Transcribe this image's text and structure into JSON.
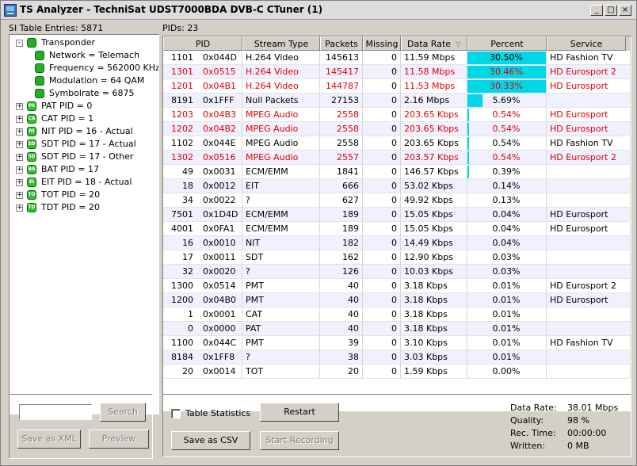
{
  "window": {
    "title": "TS Analyzer - TechniSat UDST7000BDA DVB-C CTuner (1)",
    "min_glyph": "_",
    "max_glyph": "□",
    "close_glyph": "×"
  },
  "left": {
    "label": "SI Table Entries: 5871",
    "tree": [
      {
        "text": "Transponder",
        "toggle": "-",
        "icon": "round",
        "level": 0
      },
      {
        "text": "Network = Telemach",
        "icon": "round",
        "level": 1
      },
      {
        "text": "Frequency = 562000 KHz",
        "icon": "round",
        "level": 1
      },
      {
        "text": "Modulation = 64 QAM",
        "icon": "round",
        "level": 1
      },
      {
        "text": "Symbolrate = 6875",
        "icon": "round",
        "level": 1
      },
      {
        "text": "PAT PID = 0",
        "toggle": "+",
        "icon": "table",
        "badge": "PA",
        "level": 0
      },
      {
        "text": "CAT PID = 1",
        "toggle": "+",
        "icon": "table",
        "badge": "CA",
        "level": 0
      },
      {
        "text": "NIT PID = 16 - Actual",
        "toggle": "+",
        "icon": "table",
        "badge": "NI",
        "level": 0
      },
      {
        "text": "SDT PID = 17 - Actual",
        "toggle": "+",
        "icon": "table",
        "badge": "SD",
        "level": 0
      },
      {
        "text": "SDT PID = 17 - Other",
        "toggle": "+",
        "icon": "table",
        "badge": "SD",
        "level": 0
      },
      {
        "text": "BAT PID = 17",
        "toggle": "+",
        "icon": "table",
        "badge": "BA",
        "level": 0
      },
      {
        "text": "EIT PID = 18 - Actual",
        "toggle": "+",
        "icon": "table",
        "badge": "EI",
        "level": 0
      },
      {
        "text": "TOT PID = 20",
        "toggle": "+",
        "icon": "table",
        "badge": "TO",
        "level": 0
      },
      {
        "text": "TDT PID = 20",
        "toggle": "+",
        "icon": "table",
        "badge": "TD",
        "level": 0
      }
    ],
    "search_value": "",
    "search_button": "Search",
    "save_xml_button": "Save as XML",
    "preview_button": "Preview"
  },
  "right": {
    "label": "PIDs: 23",
    "columns": [
      "PID",
      "Stream Type",
      "Packets",
      "Missing",
      "Data Rate",
      "Percent",
      "Service"
    ],
    "rows": [
      {
        "pid_dec": "1101",
        "pid_hex": "0x044D",
        "type": "H.264 Video",
        "packets": "145613",
        "missing": "0",
        "rate": "11.59 Mbps",
        "percent": "30.50%",
        "pct": 30.5,
        "service": "HD Fashion TV",
        "red": false
      },
      {
        "pid_dec": "1301",
        "pid_hex": "0x0515",
        "type": "H.264 Video",
        "packets": "145417",
        "missing": "0",
        "rate": "11.58 Mbps",
        "percent": "30.46%",
        "pct": 30.46,
        "service": "HD Eurosport 2",
        "red": true
      },
      {
        "pid_dec": "1201",
        "pid_hex": "0x04B1",
        "type": "H.264 Video",
        "packets": "144787",
        "missing": "0",
        "rate": "11.53 Mbps",
        "percent": "30.33%",
        "pct": 30.33,
        "service": "HD Eurosport",
        "red": true
      },
      {
        "pid_dec": "8191",
        "pid_hex": "0x1FFF",
        "type": "Null Packets",
        "packets": "27153",
        "missing": "0",
        "rate": "2.16 Mbps",
        "percent": "5.69%",
        "pct": 5.69,
        "service": "",
        "red": false
      },
      {
        "pid_dec": "1203",
        "pid_hex": "0x04B3",
        "type": "MPEG Audio",
        "packets": "2558",
        "missing": "0",
        "rate": "203.65 Kbps",
        "percent": "0.54%",
        "pct": 0.54,
        "service": "HD Eurosport",
        "red": true
      },
      {
        "pid_dec": "1202",
        "pid_hex": "0x04B2",
        "type": "MPEG Audio",
        "packets": "2558",
        "missing": "0",
        "rate": "203.65 Kbps",
        "percent": "0.54%",
        "pct": 0.54,
        "service": "HD Eurosport",
        "red": true
      },
      {
        "pid_dec": "1102",
        "pid_hex": "0x044E",
        "type": "MPEG Audio",
        "packets": "2558",
        "missing": "0",
        "rate": "203.65 Kbps",
        "percent": "0.54%",
        "pct": 0.54,
        "service": "HD Fashion TV",
        "red": false
      },
      {
        "pid_dec": "1302",
        "pid_hex": "0x0516",
        "type": "MPEG Audio",
        "packets": "2557",
        "missing": "0",
        "rate": "203.57 Kbps",
        "percent": "0.54%",
        "pct": 0.54,
        "service": "HD Eurosport 2",
        "red": true
      },
      {
        "pid_dec": "49",
        "pid_hex": "0x0031",
        "type": "ECM/EMM",
        "packets": "1841",
        "missing": "0",
        "rate": "146.57 Kbps",
        "percent": "0.39%",
        "pct": 0.39,
        "service": "",
        "red": false
      },
      {
        "pid_dec": "18",
        "pid_hex": "0x0012",
        "type": "EIT",
        "packets": "666",
        "missing": "0",
        "rate": "53.02 Kbps",
        "percent": "0.14%",
        "pct": 0.14,
        "service": "",
        "red": false
      },
      {
        "pid_dec": "34",
        "pid_hex": "0x0022",
        "type": "?",
        "packets": "627",
        "missing": "0",
        "rate": "49.92 Kbps",
        "percent": "0.13%",
        "pct": 0.13,
        "service": "",
        "red": false
      },
      {
        "pid_dec": "7501",
        "pid_hex": "0x1D4D",
        "type": "ECM/EMM",
        "packets": "189",
        "missing": "0",
        "rate": "15.05 Kbps",
        "percent": "0.04%",
        "pct": 0.04,
        "service": "HD Eurosport",
        "red": false
      },
      {
        "pid_dec": "4001",
        "pid_hex": "0x0FA1",
        "type": "ECM/EMM",
        "packets": "189",
        "missing": "0",
        "rate": "15.05 Kbps",
        "percent": "0.04%",
        "pct": 0.04,
        "service": "HD Eurosport",
        "red": false
      },
      {
        "pid_dec": "16",
        "pid_hex": "0x0010",
        "type": "NIT",
        "packets": "182",
        "missing": "0",
        "rate": "14.49 Kbps",
        "percent": "0.04%",
        "pct": 0.04,
        "service": "",
        "red": false
      },
      {
        "pid_dec": "17",
        "pid_hex": "0x0011",
        "type": "SDT",
        "packets": "162",
        "missing": "0",
        "rate": "12.90 Kbps",
        "percent": "0.03%",
        "pct": 0.03,
        "service": "",
        "red": false
      },
      {
        "pid_dec": "32",
        "pid_hex": "0x0020",
        "type": "?",
        "packets": "126",
        "missing": "0",
        "rate": "10.03 Kbps",
        "percent": "0.03%",
        "pct": 0.03,
        "service": "",
        "red": false
      },
      {
        "pid_dec": "1300",
        "pid_hex": "0x0514",
        "type": "PMT",
        "packets": "40",
        "missing": "0",
        "rate": "3.18 Kbps",
        "percent": "0.01%",
        "pct": 0.01,
        "service": "HD Eurosport 2",
        "red": false
      },
      {
        "pid_dec": "1200",
        "pid_hex": "0x04B0",
        "type": "PMT",
        "packets": "40",
        "missing": "0",
        "rate": "3.18 Kbps",
        "percent": "0.01%",
        "pct": 0.01,
        "service": "HD Eurosport",
        "red": false
      },
      {
        "pid_dec": "1",
        "pid_hex": "0x0001",
        "type": "CAT",
        "packets": "40",
        "missing": "0",
        "rate": "3.18 Kbps",
        "percent": "0.01%",
        "pct": 0.01,
        "service": "",
        "red": false
      },
      {
        "pid_dec": "0",
        "pid_hex": "0x0000",
        "type": "PAT",
        "packets": "40",
        "missing": "0",
        "rate": "3.18 Kbps",
        "percent": "0.01%",
        "pct": 0.01,
        "service": "",
        "red": false
      },
      {
        "pid_dec": "1100",
        "pid_hex": "0x044C",
        "type": "PMT",
        "packets": "39",
        "missing": "0",
        "rate": "3.10 Kbps",
        "percent": "0.01%",
        "pct": 0.01,
        "service": "HD Fashion TV",
        "red": false
      },
      {
        "pid_dec": "8184",
        "pid_hex": "0x1FF8",
        "type": "?",
        "packets": "38",
        "missing": "0",
        "rate": "3.03 Kbps",
        "percent": "0.01%",
        "pct": 0.01,
        "service": "",
        "red": false
      },
      {
        "pid_dec": "20",
        "pid_hex": "0x0014",
        "type": "TOT",
        "packets": "20",
        "missing": "0",
        "rate": "1.59 Kbps",
        "percent": "0.00%",
        "pct": 0.0,
        "service": "",
        "red": false
      }
    ],
    "table_statistics_label": "Table Statistics",
    "restart_button": "Restart",
    "save_csv_button": "Save as CSV",
    "start_recording_button": "Start Recording",
    "stats": [
      {
        "label": "Data Rate:",
        "value": "38.01 Mbps"
      },
      {
        "label": "Quality:",
        "value": "98 %"
      },
      {
        "label": "Rec. Time:",
        "value": "00:00:00"
      },
      {
        "label": "Written:",
        "value": "0 MB"
      }
    ]
  },
  "colors": {
    "red_row": "#e00000",
    "percent_bar": "#00d8e8",
    "alt_row": "#f0f0ff"
  }
}
